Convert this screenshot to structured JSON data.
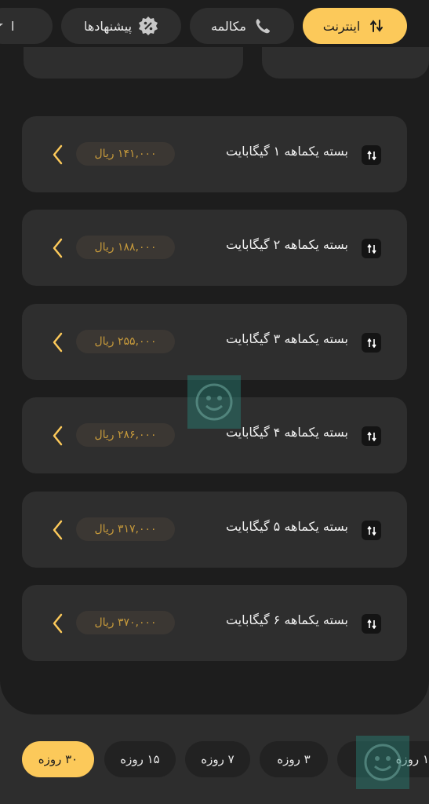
{
  "top_tabs": [
    {
      "label": "اینترنت",
      "icon": "data-arrows-icon",
      "active": true
    },
    {
      "label": "مکالمه",
      "icon": "phone-icon",
      "active": false
    },
    {
      "label": "پیشنهادها",
      "icon": "percent-badge-icon",
      "active": false
    },
    {
      "label": "ا",
      "icon": "star-icon",
      "active": false
    }
  ],
  "packages": [
    {
      "title": "بسته یکماهه ۱ گیگابایت",
      "price": "۱۴۱,۰۰۰ ریال"
    },
    {
      "title": "بسته یکماهه ۲ گیگابایت",
      "price": "۱۸۸,۰۰۰ ریال"
    },
    {
      "title": "بسته یکماهه ۳ گیگابایت",
      "price": "۲۵۵,۰۰۰ ریال"
    },
    {
      "title": "بسته یکماهه ۴ گیگابایت",
      "price": "۲۸۶,۰۰۰ ریال"
    },
    {
      "title": "بسته یکماهه ۵ گیگابایت",
      "price": "۳۱۷,۰۰۰ ریال"
    },
    {
      "title": "بسته یکماهه ۶ گیگابایت",
      "price": "۳۷۰,۰۰۰ ریال"
    }
  ],
  "duration_tabs": [
    {
      "label": "۳۰ روزه",
      "active": true
    },
    {
      "label": "۱۵ روزه",
      "active": false
    },
    {
      "label": "۷ روزه",
      "active": false
    },
    {
      "label": "۳ روزه",
      "active": false
    },
    {
      "label": "۱ روزه",
      "active": false
    }
  ],
  "colors": {
    "accent": "#fcc95a",
    "price_text": "#c79a3b",
    "background": "#1d1d1d",
    "card": "#2e2e2e"
  }
}
